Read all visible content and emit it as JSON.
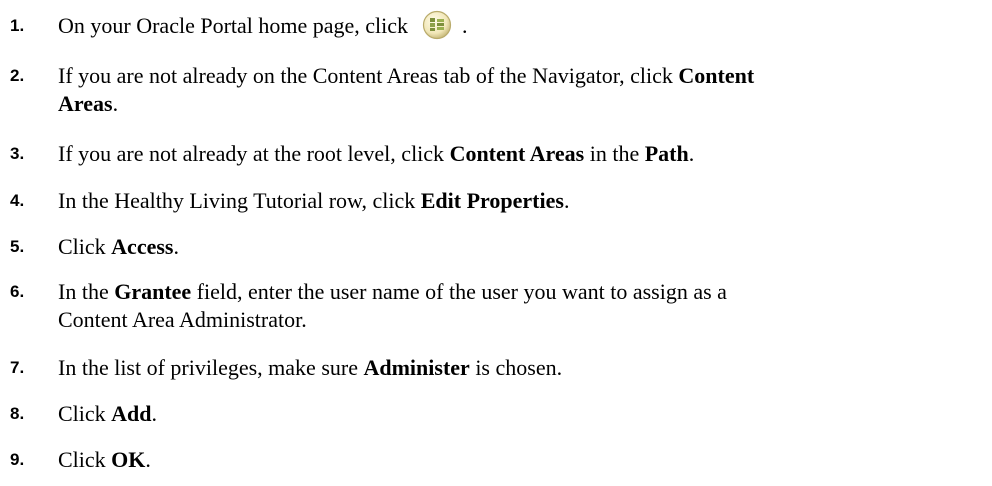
{
  "steps": [
    {
      "number": "1.",
      "text_before": "On your Oracle Portal home page, click",
      "icon": "navigator-icon",
      "text_after": "."
    },
    {
      "number": "2.",
      "p1": "If you are not already on the Content Areas tab of the Navigator, click ",
      "b1": "Content",
      "p2": "",
      "b2": "Areas",
      "p3": "."
    },
    {
      "number": "3.",
      "p1": "If you are not already at the root level, click ",
      "b1": "Content Areas",
      "p2": " in the ",
      "b2": "Path",
      "p3": "."
    },
    {
      "number": "4.",
      "p1": "In the Healthy Living Tutorial row, click ",
      "b1": "Edit Properties",
      "p2": "."
    },
    {
      "number": "5.",
      "p1": "Click ",
      "b1": "Access",
      "p2": "."
    },
    {
      "number": "6.",
      "p1": "In the ",
      "b1": "Grantee",
      "p2": " field, enter the user name of the user you want to assign as a",
      "line2": "Content Area Administrator."
    },
    {
      "number": "7.",
      "p1": "In the list of privileges, make sure ",
      "b1": "Administer",
      "p2": " is chosen."
    },
    {
      "number": "8.",
      "p1": "Click ",
      "b1": "Add",
      "p2": "."
    },
    {
      "number": "9.",
      "p1": "Click ",
      "b1": "OK",
      "p2": "."
    }
  ]
}
